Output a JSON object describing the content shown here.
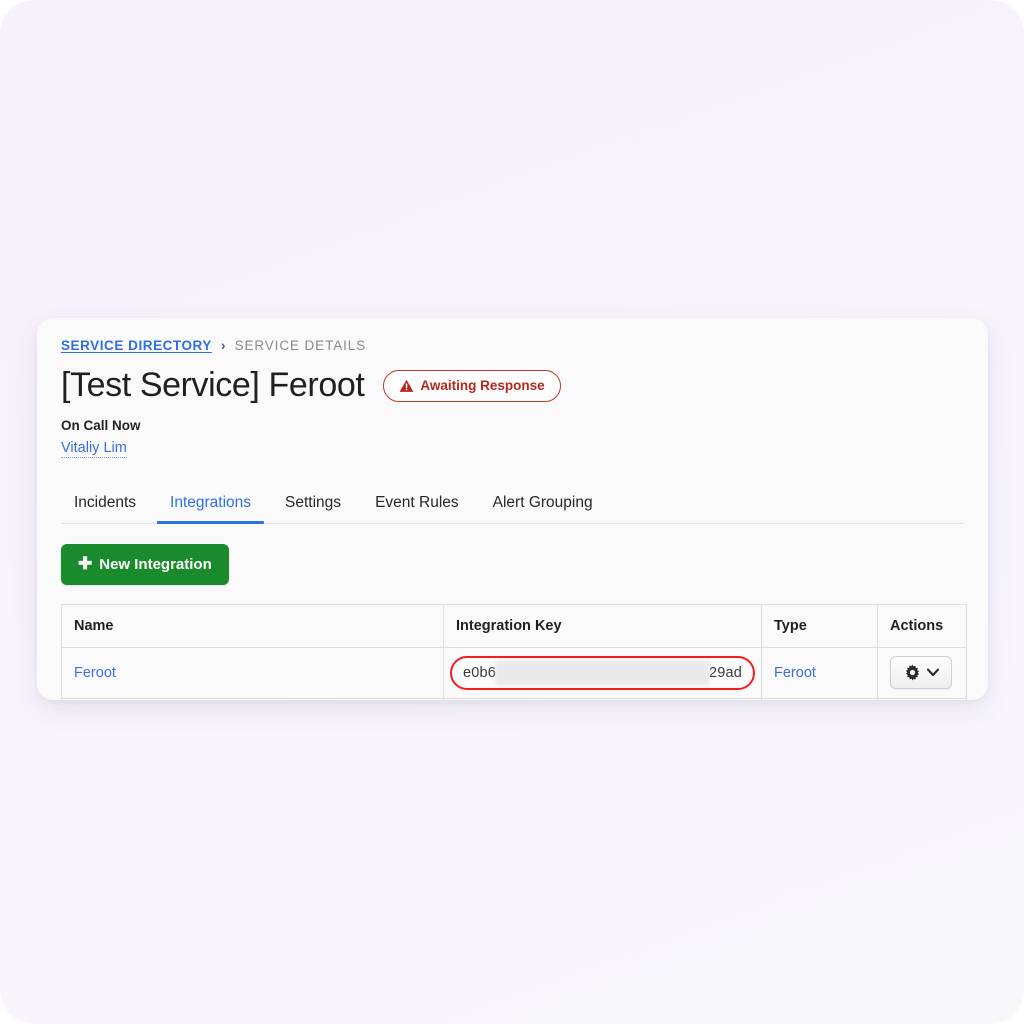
{
  "breadcrumb": {
    "parent": "SERVICE DIRECTORY",
    "separator": "›",
    "current": "SERVICE DETAILS"
  },
  "header": {
    "title": "[Test Service] Feroot",
    "status_badge": {
      "label": "Awaiting Response",
      "icon": "warning-triangle-icon",
      "color": "#b02a1f"
    },
    "on_call_label": "On Call Now",
    "on_call_person": "Vitaliy Lim"
  },
  "tabs": [
    {
      "label": "Incidents",
      "active": false
    },
    {
      "label": "Integrations",
      "active": true
    },
    {
      "label": "Settings",
      "active": false
    },
    {
      "label": "Event Rules",
      "active": false
    },
    {
      "label": "Alert Grouping",
      "active": false
    }
  ],
  "toolbar": {
    "new_integration_label": "New Integration",
    "new_integration_icon": "plus-icon",
    "new_integration_color": "#1a8b2c"
  },
  "table": {
    "columns": [
      "Name",
      "Integration Key",
      "Type",
      "Actions"
    ],
    "rows": [
      {
        "name": "Feroot",
        "key_prefix": "e0b6",
        "key_suffix": "29ad",
        "key_redacted": true,
        "type": "Feroot",
        "action_icon": "gear-icon",
        "action_caret": "chevron-down-icon"
      }
    ]
  },
  "annotation": {
    "highlight_color": "#f21d1d",
    "target": "integration-key-cell"
  },
  "theme": {
    "link_color": "#3b6fe4",
    "accent_blue": "#2f6fe4",
    "page_background": "#f7f3fb",
    "card_background": "#fafafa"
  }
}
